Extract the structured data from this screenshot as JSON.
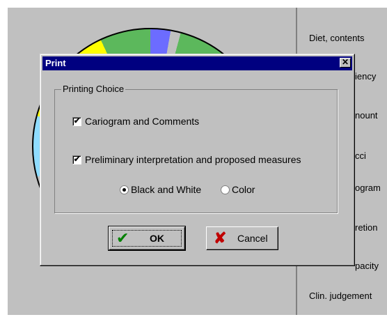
{
  "background": {
    "right_labels": [
      "Diet, contents",
      "iency",
      "nount",
      "cci",
      "ogram",
      "retion",
      "pacity",
      "Clin. judgement"
    ]
  },
  "dialog": {
    "title": "Print",
    "close_glyph": "✕",
    "group_label": "Printing Choice",
    "checkboxes": [
      {
        "label": "Cariogram and Comments",
        "checked": true
      },
      {
        "label": "Preliminary interpretation and proposed measures",
        "checked": true
      }
    ],
    "radios": [
      {
        "label": "Black and White",
        "selected": true
      },
      {
        "label": "Color",
        "selected": false
      }
    ],
    "buttons": {
      "ok": {
        "label": "OK",
        "icon": "check-icon",
        "icon_color": "#008000"
      },
      "cancel": {
        "label": "Cancel",
        "icon": "x-icon",
        "icon_color": "#c00000"
      }
    },
    "check_glyph": "✔"
  },
  "colors": {
    "titlebar": "#000080",
    "face": "#c0c0c0",
    "pie_green": "#5cb85c",
    "pie_yellow": "#ffff00",
    "pie_cyan": "#8fdcff",
    "pie_red": "#ff6b6b",
    "pie_blue": "#6c6cff"
  }
}
